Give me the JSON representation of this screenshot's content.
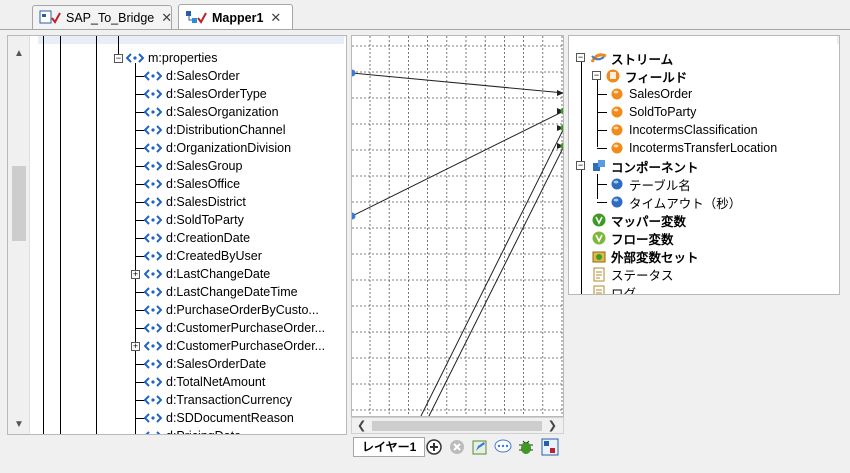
{
  "tabs": [
    {
      "label": "SAP_To_Bridge",
      "active": false
    },
    {
      "label": "Mapper1",
      "active": true
    }
  ],
  "left_tree": {
    "root": "m:properties",
    "items": [
      {
        "label": "d:SalesOrder"
      },
      {
        "label": "d:SalesOrderType"
      },
      {
        "label": "d:SalesOrganization"
      },
      {
        "label": "d:DistributionChannel"
      },
      {
        "label": "d:OrganizationDivision"
      },
      {
        "label": "d:SalesGroup"
      },
      {
        "label": "d:SalesOffice"
      },
      {
        "label": "d:SalesDistrict"
      },
      {
        "label": "d:SoldToParty"
      },
      {
        "label": "d:CreationDate"
      },
      {
        "label": "d:CreatedByUser"
      },
      {
        "label": "d:LastChangeDate"
      },
      {
        "label": "d:LastChangeDateTime"
      },
      {
        "label": "d:PurchaseOrderByCusto..."
      },
      {
        "label": "d:CustomerPurchaseOrder..."
      },
      {
        "label": "d:CustomerPurchaseOrder..."
      },
      {
        "label": "d:SalesOrderDate"
      },
      {
        "label": "d:TotalNetAmount"
      },
      {
        "label": "d:TransactionCurrency"
      },
      {
        "label": "d:SDDocumentReason"
      },
      {
        "label": "d:PricingDate"
      }
    ]
  },
  "layer": {
    "tab_label": "レイヤー1"
  },
  "right_tree": {
    "stream": "ストリーム",
    "fields": "フィールド",
    "field_items": [
      "SalesOrder",
      "SoldToParty",
      "IncotermsClassification",
      "IncotermsTransferLocation"
    ],
    "component": "コンポーネント",
    "component_items": [
      "テーブル名",
      "タイムアウト（秒）"
    ],
    "mapper_vars": "マッパー変数",
    "flow_vars": "フロー変数",
    "external_vars": "外部変数セット",
    "status": "ステータス",
    "log": "ログ"
  },
  "colors": {
    "arrow_blue": "#1e63c8",
    "field_orange": "#f08a1c",
    "component_blue": "#2d6cc0",
    "var_green": "#3e9a22"
  }
}
